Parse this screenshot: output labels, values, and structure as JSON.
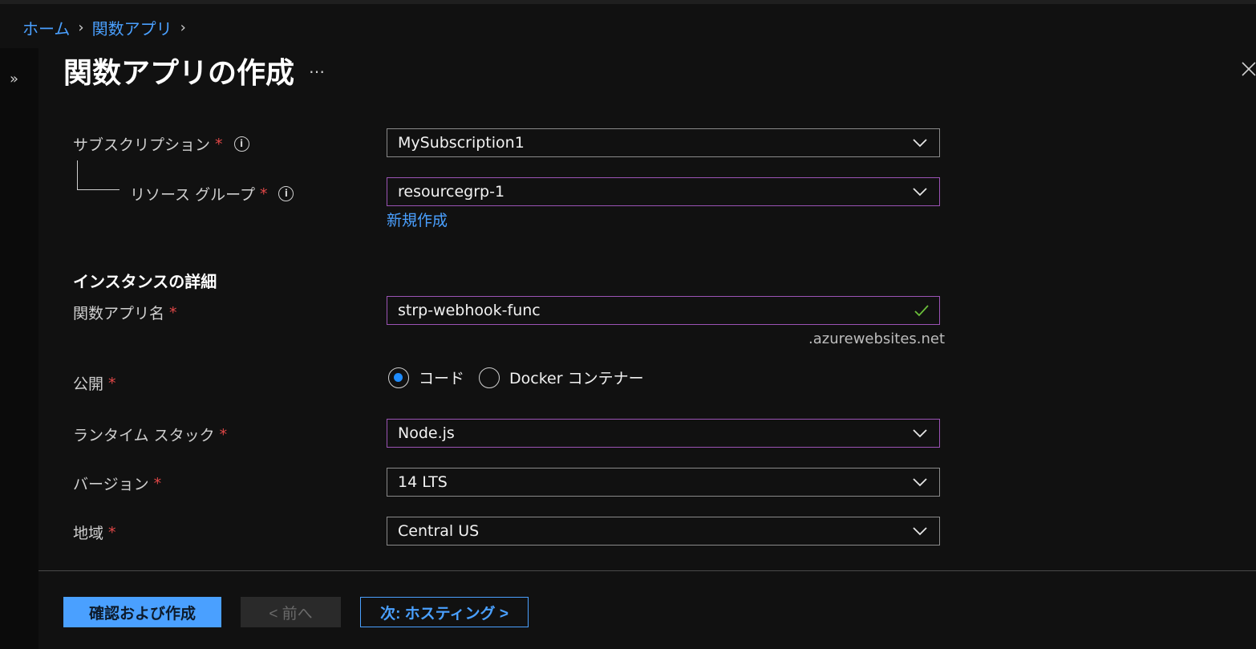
{
  "breadcrumb": {
    "home": "ホーム",
    "function_app": "関数アプリ"
  },
  "page": {
    "title": "関数アプリの作成",
    "more": "…"
  },
  "form": {
    "subscription": {
      "label": "サブスクリプション",
      "value": "MySubscription1"
    },
    "resource_group": {
      "label": "リソース グループ",
      "value": "resourcegrp-1",
      "create_new": "新規作成"
    },
    "instance_section": "インスタンスの詳細",
    "app_name": {
      "label": "関数アプリ名",
      "value": "strp-webhook-func",
      "suffix": ".azurewebsites.net"
    },
    "publish": {
      "label": "公開",
      "options": [
        "コード",
        "Docker コンテナー"
      ],
      "selected": "コード"
    },
    "runtime_stack": {
      "label": "ランタイム スタック",
      "value": "Node.js"
    },
    "version": {
      "label": "バージョン",
      "value": "14 LTS"
    },
    "region": {
      "label": "地域",
      "value": "Central US"
    },
    "required_mark": "*"
  },
  "footer": {
    "review_create": "確認および作成",
    "previous": "< 前へ",
    "next": "次: ホスティング >"
  },
  "colors": {
    "accent": "#4aa0ff",
    "required": "#e04747",
    "focus_border": "#9b53b5",
    "valid": "#6bbf3a"
  }
}
